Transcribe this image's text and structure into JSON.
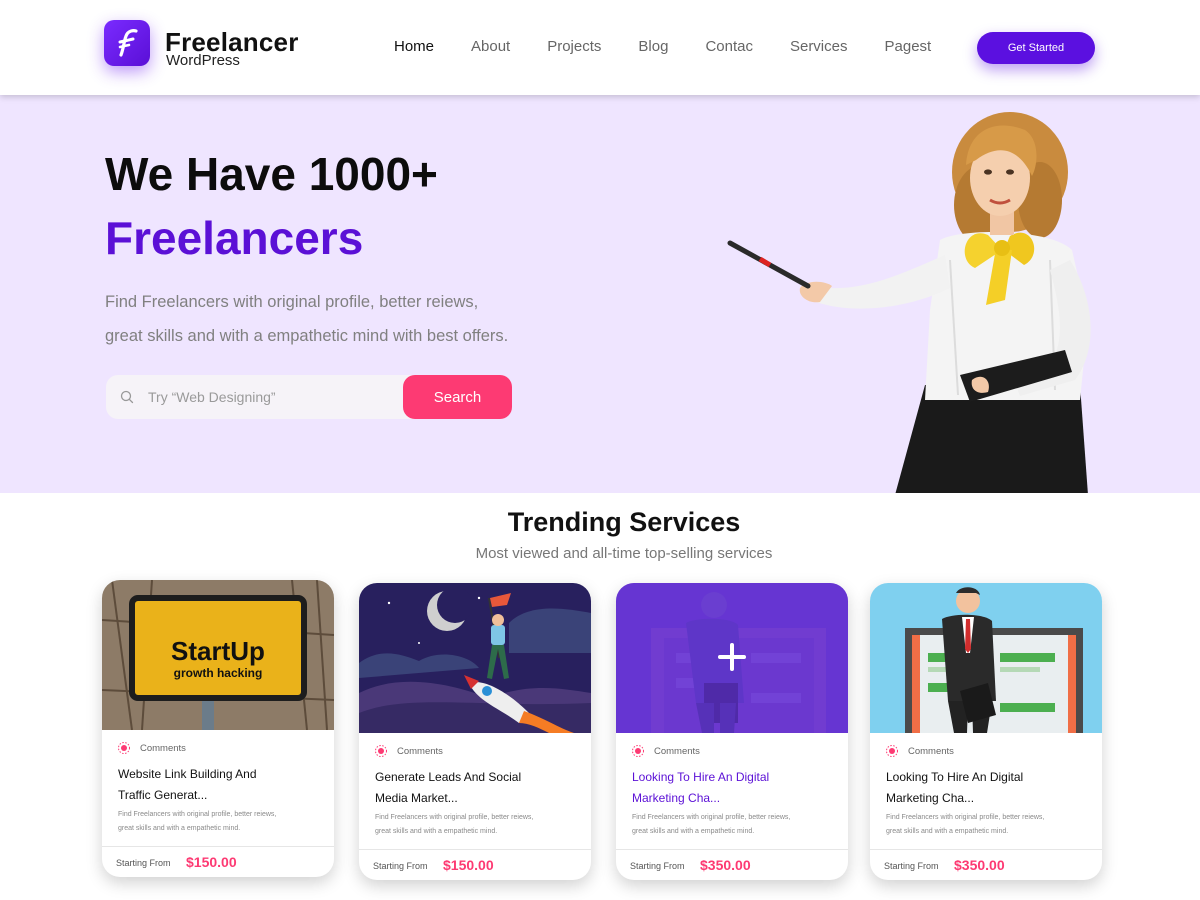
{
  "brand": {
    "name": "Freelancer",
    "sub": "WordPress"
  },
  "nav": [
    "Home",
    "About",
    "Projects",
    "Blog",
    "Contac",
    "Services",
    "Pagest"
  ],
  "header": {
    "cta": "Get Started"
  },
  "hero": {
    "line1": "We Have 1000+",
    "line2": "Freelancers",
    "desc1": "Find Freelancers with original profile, better reiews,",
    "desc2": "great skills and with  a empathetic mind with best offers.",
    "search_placeholder": "Try “Web Designing”",
    "search_button": "Search"
  },
  "trending": {
    "title": "Trending Services",
    "subtitle": "Most viewed and all-time top-selling services",
    "cards": [
      {
        "image": "startup-sign",
        "image_text1": "StartUp",
        "image_text2": "growth hacking",
        "category": "Comments",
        "title1": "Website Link Building And",
        "title2": "Traffic Generat...",
        "desc1": "Find Freelancers with original profile, better reiews,",
        "desc2": "great skills and with  a empathetic mind.",
        "price_label": "Starting From",
        "price": "$150.00"
      },
      {
        "image": "rocket-moon",
        "category": "Comments",
        "title1": "Generate Leads And Social",
        "title2": "Media Market...",
        "desc1": "Find Freelancers with original profile, better reiews,",
        "desc2": "great skills and with  a empathetic mind.",
        "price_label": "Starting From",
        "price": "$150.00"
      },
      {
        "image": "businessman-purple",
        "category": "Comments",
        "title1": "Looking To Hire An Digital",
        "title2": "Marketing Cha...",
        "desc1": "Find Freelancers with original profile, better reiews,",
        "desc2": "great skills and with  a empathetic mind.",
        "price_label": "Starting From",
        "price": "$350.00"
      },
      {
        "image": "businessman-blue",
        "category": "Comments",
        "title1": "Looking To Hire An Digital",
        "title2": "Marketing Cha...",
        "desc1": "Find Freelancers with original profile, better reiews,",
        "desc2": "great skills and with  a empathetic mind.",
        "price_label": "Starting From",
        "price": "$350.00"
      }
    ]
  },
  "colors": {
    "brand": "#5b10e0",
    "accent": "#fd3a73",
    "hero_bg": "#efe5ff",
    "purple_text": "#5b10d6"
  }
}
